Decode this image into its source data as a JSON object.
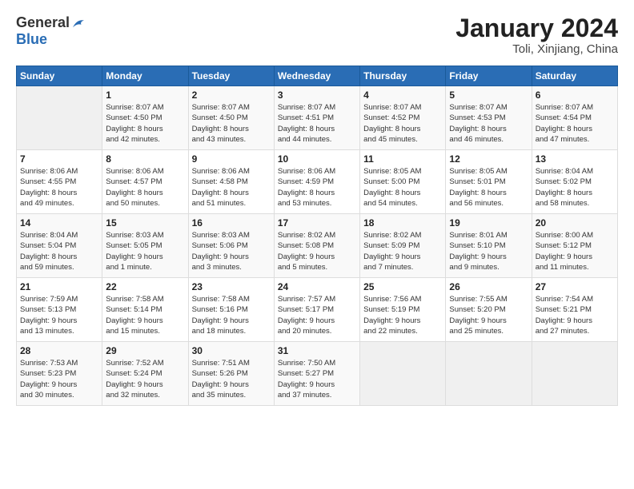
{
  "header": {
    "logo_general": "General",
    "logo_blue": "Blue",
    "title": "January 2024",
    "subtitle": "Toli, Xinjiang, China"
  },
  "columns": [
    "Sunday",
    "Monday",
    "Tuesday",
    "Wednesday",
    "Thursday",
    "Friday",
    "Saturday"
  ],
  "weeks": [
    [
      {
        "day": "",
        "info": ""
      },
      {
        "day": "1",
        "info": "Sunrise: 8:07 AM\nSunset: 4:50 PM\nDaylight: 8 hours\nand 42 minutes."
      },
      {
        "day": "2",
        "info": "Sunrise: 8:07 AM\nSunset: 4:50 PM\nDaylight: 8 hours\nand 43 minutes."
      },
      {
        "day": "3",
        "info": "Sunrise: 8:07 AM\nSunset: 4:51 PM\nDaylight: 8 hours\nand 44 minutes."
      },
      {
        "day": "4",
        "info": "Sunrise: 8:07 AM\nSunset: 4:52 PM\nDaylight: 8 hours\nand 45 minutes."
      },
      {
        "day": "5",
        "info": "Sunrise: 8:07 AM\nSunset: 4:53 PM\nDaylight: 8 hours\nand 46 minutes."
      },
      {
        "day": "6",
        "info": "Sunrise: 8:07 AM\nSunset: 4:54 PM\nDaylight: 8 hours\nand 47 minutes."
      }
    ],
    [
      {
        "day": "7",
        "info": "Sunrise: 8:06 AM\nSunset: 4:55 PM\nDaylight: 8 hours\nand 49 minutes."
      },
      {
        "day": "8",
        "info": "Sunrise: 8:06 AM\nSunset: 4:57 PM\nDaylight: 8 hours\nand 50 minutes."
      },
      {
        "day": "9",
        "info": "Sunrise: 8:06 AM\nSunset: 4:58 PM\nDaylight: 8 hours\nand 51 minutes."
      },
      {
        "day": "10",
        "info": "Sunrise: 8:06 AM\nSunset: 4:59 PM\nDaylight: 8 hours\nand 53 minutes."
      },
      {
        "day": "11",
        "info": "Sunrise: 8:05 AM\nSunset: 5:00 PM\nDaylight: 8 hours\nand 54 minutes."
      },
      {
        "day": "12",
        "info": "Sunrise: 8:05 AM\nSunset: 5:01 PM\nDaylight: 8 hours\nand 56 minutes."
      },
      {
        "day": "13",
        "info": "Sunrise: 8:04 AM\nSunset: 5:02 PM\nDaylight: 8 hours\nand 58 minutes."
      }
    ],
    [
      {
        "day": "14",
        "info": "Sunrise: 8:04 AM\nSunset: 5:04 PM\nDaylight: 8 hours\nand 59 minutes."
      },
      {
        "day": "15",
        "info": "Sunrise: 8:03 AM\nSunset: 5:05 PM\nDaylight: 9 hours\nand 1 minute."
      },
      {
        "day": "16",
        "info": "Sunrise: 8:03 AM\nSunset: 5:06 PM\nDaylight: 9 hours\nand 3 minutes."
      },
      {
        "day": "17",
        "info": "Sunrise: 8:02 AM\nSunset: 5:08 PM\nDaylight: 9 hours\nand 5 minutes."
      },
      {
        "day": "18",
        "info": "Sunrise: 8:02 AM\nSunset: 5:09 PM\nDaylight: 9 hours\nand 7 minutes."
      },
      {
        "day": "19",
        "info": "Sunrise: 8:01 AM\nSunset: 5:10 PM\nDaylight: 9 hours\nand 9 minutes."
      },
      {
        "day": "20",
        "info": "Sunrise: 8:00 AM\nSunset: 5:12 PM\nDaylight: 9 hours\nand 11 minutes."
      }
    ],
    [
      {
        "day": "21",
        "info": "Sunrise: 7:59 AM\nSunset: 5:13 PM\nDaylight: 9 hours\nand 13 minutes."
      },
      {
        "day": "22",
        "info": "Sunrise: 7:58 AM\nSunset: 5:14 PM\nDaylight: 9 hours\nand 15 minutes."
      },
      {
        "day": "23",
        "info": "Sunrise: 7:58 AM\nSunset: 5:16 PM\nDaylight: 9 hours\nand 18 minutes."
      },
      {
        "day": "24",
        "info": "Sunrise: 7:57 AM\nSunset: 5:17 PM\nDaylight: 9 hours\nand 20 minutes."
      },
      {
        "day": "25",
        "info": "Sunrise: 7:56 AM\nSunset: 5:19 PM\nDaylight: 9 hours\nand 22 minutes."
      },
      {
        "day": "26",
        "info": "Sunrise: 7:55 AM\nSunset: 5:20 PM\nDaylight: 9 hours\nand 25 minutes."
      },
      {
        "day": "27",
        "info": "Sunrise: 7:54 AM\nSunset: 5:21 PM\nDaylight: 9 hours\nand 27 minutes."
      }
    ],
    [
      {
        "day": "28",
        "info": "Sunrise: 7:53 AM\nSunset: 5:23 PM\nDaylight: 9 hours\nand 30 minutes."
      },
      {
        "day": "29",
        "info": "Sunrise: 7:52 AM\nSunset: 5:24 PM\nDaylight: 9 hours\nand 32 minutes."
      },
      {
        "day": "30",
        "info": "Sunrise: 7:51 AM\nSunset: 5:26 PM\nDaylight: 9 hours\nand 35 minutes."
      },
      {
        "day": "31",
        "info": "Sunrise: 7:50 AM\nSunset: 5:27 PM\nDaylight: 9 hours\nand 37 minutes."
      },
      {
        "day": "",
        "info": ""
      },
      {
        "day": "",
        "info": ""
      },
      {
        "day": "",
        "info": ""
      }
    ]
  ]
}
